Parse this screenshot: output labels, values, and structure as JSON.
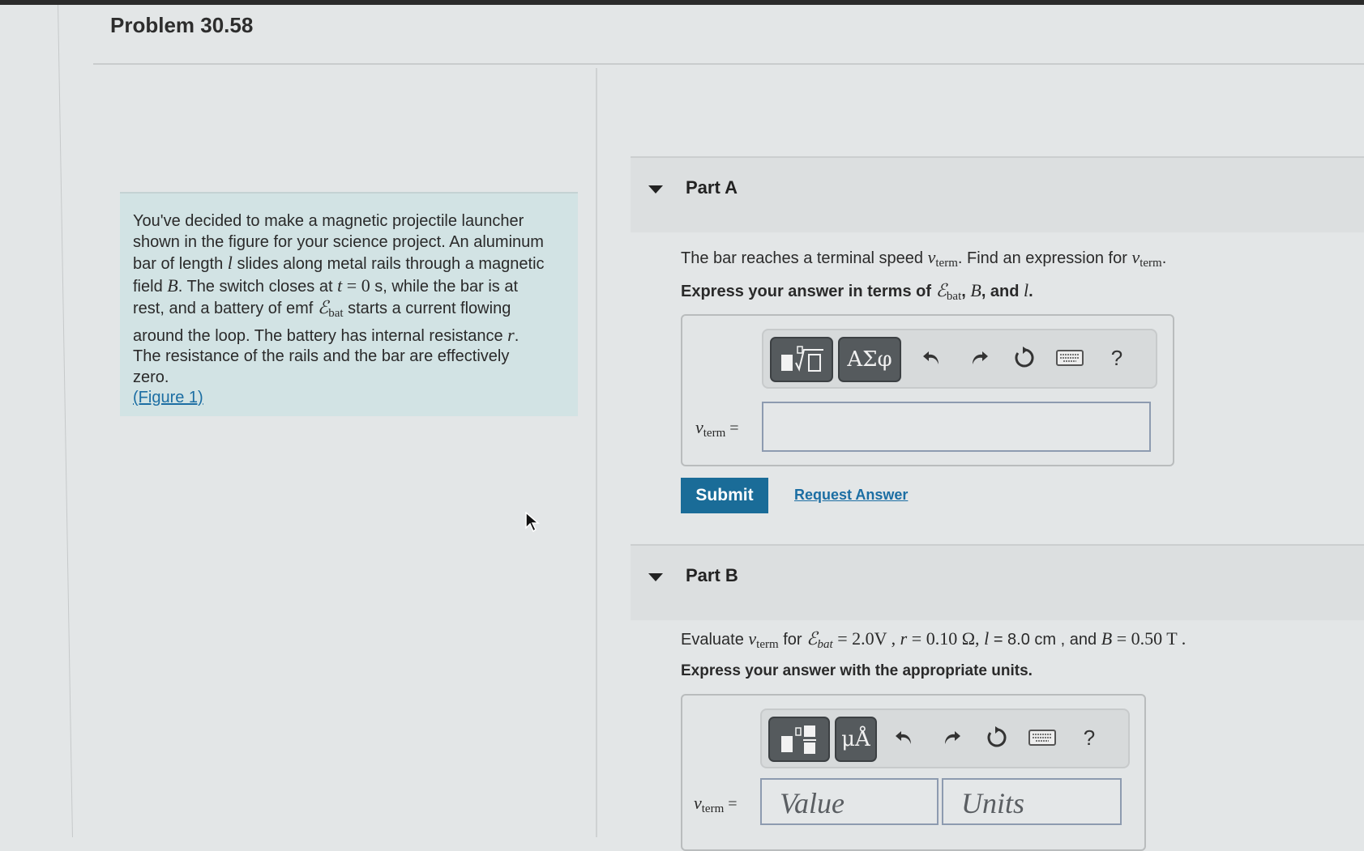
{
  "page": {
    "title": "Problem 30.58"
  },
  "problem": {
    "lines": [
      "You've decided to make a magnetic projectile launcher",
      "shown in the figure for your science project. An aluminum",
      "bar of length",
      "slides along metal rails through a magnetic",
      "field",
      ". The switch closes at",
      "s, while the bar is at",
      "rest, and a battery of emf",
      "starts a current flowing",
      "around the loop. The battery has internal resistance",
      "The resistance of the rails and the bar are effectively",
      "zero."
    ],
    "sym_l": "l",
    "sym_B": "B",
    "sym_t": "t",
    "eq_zero": "= 0",
    "sym_E": "ℰ",
    "sub_bat": "bat",
    "sym_r": "r",
    "figure_link": "(Figure 1)"
  },
  "partA": {
    "label": "Part A",
    "question_pre": "The bar reaches a terminal speed",
    "question_mid": ". Find an expression for",
    "sym_v": "v",
    "sub_term": "term",
    "instruction_pre": "Express your answer in terms of",
    "instruction_post": ", and",
    "sym_E": "ℰ",
    "sub_bat": "bat",
    "sym_B": "B",
    "sym_l": "l",
    "toolbar": {
      "template_btn": "templates",
      "greek_btn": "ΑΣφ",
      "undo": "undo",
      "redo": "redo",
      "reset": "reset",
      "keyboard": "keyboard",
      "help": "?"
    },
    "answer_label_v": "v",
    "answer_label_sub": "term",
    "answer_eq": "=",
    "answer_value": "",
    "submit": "Submit",
    "request_answer": "Request Answer"
  },
  "partB": {
    "label": "Part B",
    "q_evaluate": "Evaluate",
    "q_for": "for",
    "E_value": "= 2.0V ,",
    "r_value": "= 0.10 Ω,",
    "l_value": "= 8.0 cm ,",
    "and": "and",
    "B_value": "= 0.50 T .",
    "sub_bat_italic": "bat",
    "instruction": "Express your answer with the appropriate units.",
    "toolbar": {
      "units_template_btn": "templates",
      "units_btn": "μÅ",
      "help": "?"
    },
    "answer_label_v": "v",
    "answer_label_sub": "term",
    "answer_eq": "=",
    "value_placeholder": "Value",
    "units_placeholder": "Units"
  }
}
